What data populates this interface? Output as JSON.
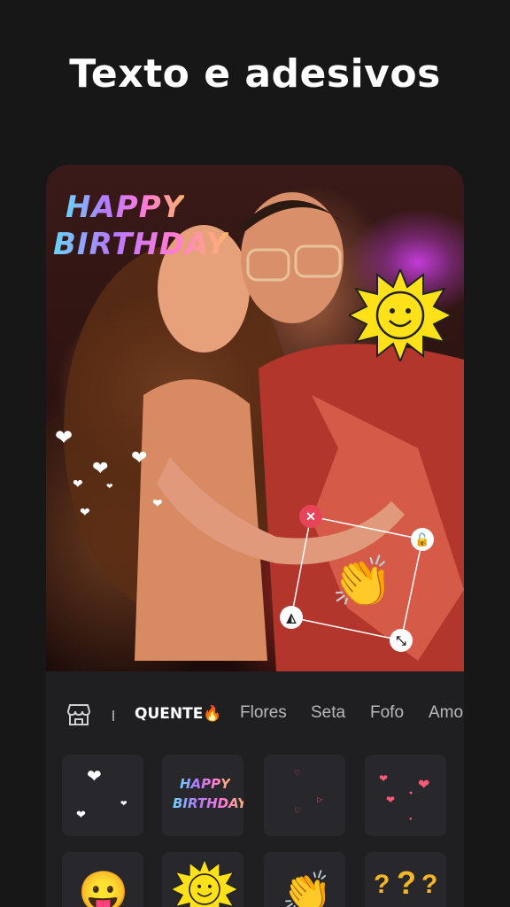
{
  "header": {
    "title": "Texto e adesivos"
  },
  "photo": {
    "sticker_text_line1": "HAPPY",
    "sticker_text_line2": "BIRTHDAY"
  },
  "sticker_controls": {
    "close_glyph": "✕",
    "lock_glyph": "🔓",
    "flip_glyph": "◭",
    "scale_glyph": "⤡"
  },
  "tabs": [
    {
      "label": "QUENTE🔥",
      "active": true
    },
    {
      "label": "Flores",
      "active": false
    },
    {
      "label": "Seta",
      "active": false
    },
    {
      "label": "Fofo",
      "active": false
    },
    {
      "label": "Amo",
      "active": false
    }
  ],
  "tiles": {
    "hb_line1": "HAPPY",
    "hb_line2": "BIRTHDAY"
  },
  "colors": {
    "background": "#171717",
    "panel": "#1f1f22",
    "tile": "#28282c",
    "close_button": "#e7445a",
    "sun_yellow": "#ffe11a"
  }
}
